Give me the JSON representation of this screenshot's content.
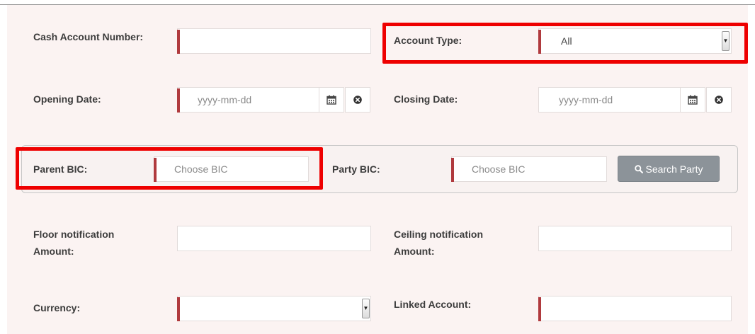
{
  "form": {
    "cash_account_number": {
      "label": "Cash Account Number:",
      "value": ""
    },
    "account_type": {
      "label": "Account Type:",
      "selected": "All"
    },
    "opening_date": {
      "label": "Opening Date:",
      "placeholder": "yyyy-mm-dd"
    },
    "closing_date": {
      "label": "Closing Date:",
      "placeholder": "yyyy-mm-dd"
    },
    "parent_bic": {
      "label": "Parent BIC:",
      "placeholder": "Choose BIC"
    },
    "party_bic": {
      "label": "Party BIC:",
      "placeholder": "Choose BIC"
    },
    "search_party_button": {
      "label": "Search Party"
    },
    "floor_notification": {
      "label_line1": "Floor notification",
      "label_line2": "Amount:"
    },
    "ceiling_notification": {
      "label_line1": "Ceiling notification",
      "label_line2": "Amount:"
    },
    "currency": {
      "label": "Currency:",
      "selected": ""
    },
    "linked_account": {
      "label": "Linked Account:",
      "value": ""
    }
  },
  "colors": {
    "required_marker": "#b03a3e",
    "highlight": "#ee0000",
    "button": "#8c9399",
    "panel_background": "#fbf3f2"
  },
  "icons": {
    "calendar": "calendar-icon",
    "clear": "clear-circle-icon",
    "search": "search-icon",
    "dropdown": "dropdown-arrow-icon"
  }
}
